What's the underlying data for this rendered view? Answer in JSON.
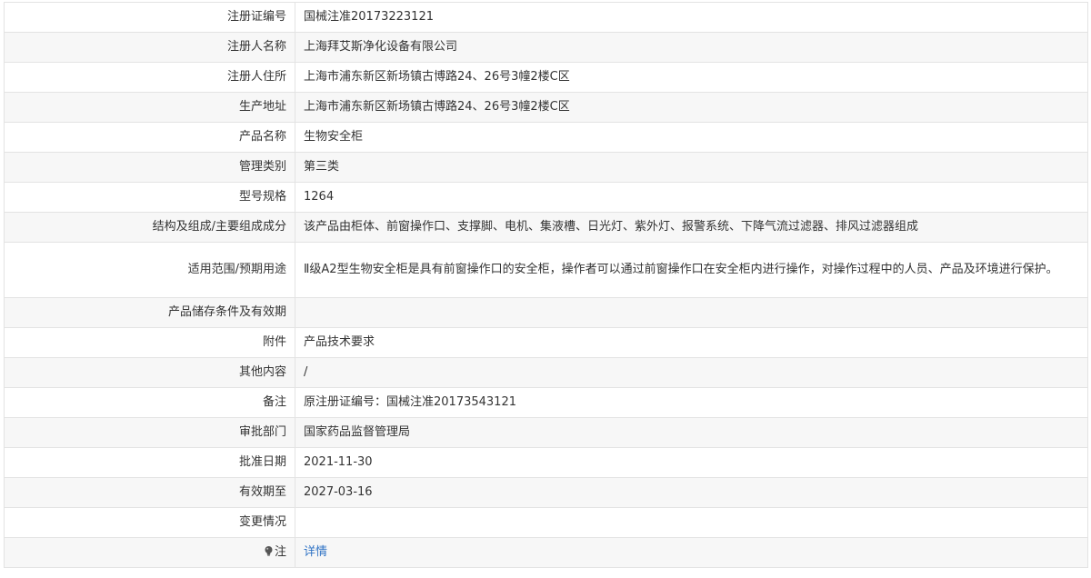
{
  "rows": [
    {
      "label": "注册证编号",
      "value": "国械注准20173223121"
    },
    {
      "label": "注册人名称",
      "value": "上海拜艾斯净化设备有限公司"
    },
    {
      "label": "注册人住所",
      "value": "上海市浦东新区新场镇古博路24、26号3幢2楼C区"
    },
    {
      "label": "生产地址",
      "value": "上海市浦东新区新场镇古博路24、26号3幢2楼C区"
    },
    {
      "label": "产品名称",
      "value": "生物安全柜"
    },
    {
      "label": "管理类别",
      "value": "第三类"
    },
    {
      "label": "型号规格",
      "value": "1264"
    },
    {
      "label": "结构及组成/主要组成成分",
      "value": "该产品由柜体、前窗操作口、支撑脚、电机、集液槽、日光灯、紫外灯、报警系统、下降气流过滤器、排风过滤器组成"
    },
    {
      "label": "适用范围/预期用途",
      "value": "Ⅱ级A2型生物安全柜是具有前窗操作口的安全柜，操作者可以通过前窗操作口在安全柜内进行操作，对操作过程中的人员、产品及环境进行保护。"
    },
    {
      "label": "产品储存条件及有效期",
      "value": ""
    },
    {
      "label": "附件",
      "value": "产品技术要求"
    },
    {
      "label": "其他内容",
      "value": "/"
    },
    {
      "label": "备注",
      "value": "原注册证编号：国械注准20173543121"
    },
    {
      "label": "审批部门",
      "value": "国家药品监督管理局"
    },
    {
      "label": "批准日期",
      "value": "2021-11-30"
    },
    {
      "label": "有效期至",
      "value": "2027-03-16"
    },
    {
      "label": "变更情况",
      "value": ""
    }
  ],
  "note_row": {
    "icon": "lightbulb-icon",
    "label": "注",
    "link_text": "详情"
  },
  "colors": {
    "border": "#e3e3e3",
    "row_alt": "#f7f7f7",
    "link": "#2f73c5",
    "text": "#333333"
  }
}
